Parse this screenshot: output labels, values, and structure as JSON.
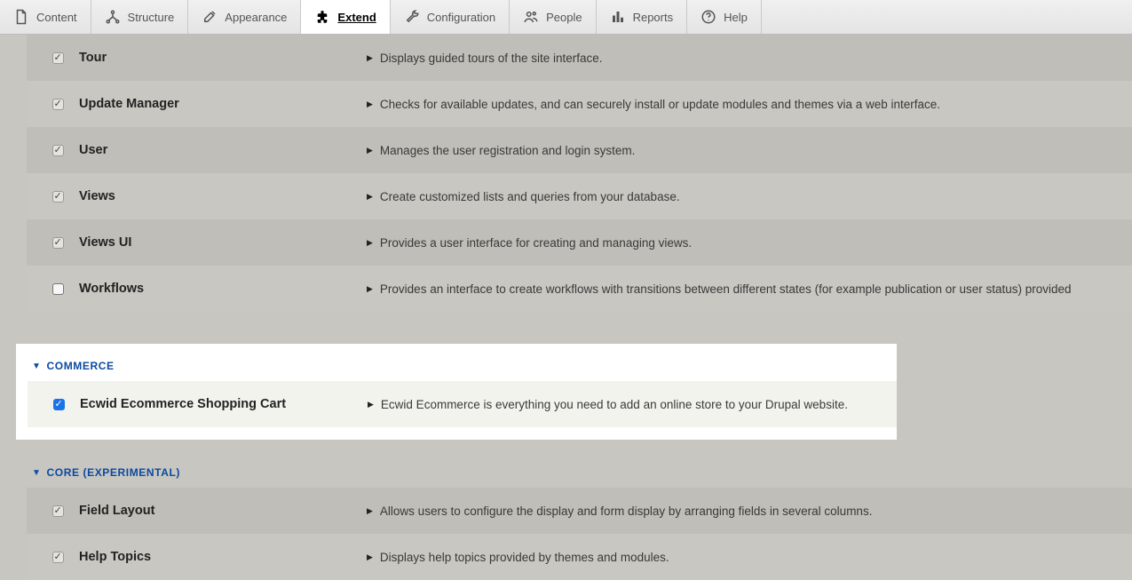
{
  "toolbar": {
    "content": "Content",
    "structure": "Structure",
    "appearance": "Appearance",
    "extend": "Extend",
    "configuration": "Configuration",
    "people": "People",
    "reports": "Reports",
    "help": "Help"
  },
  "sections": {
    "core_top": {
      "rows": [
        {
          "name": "Tour",
          "desc": "Displays guided tours of the site interface.",
          "checked": true,
          "disabled": true
        },
        {
          "name": "Update Manager",
          "desc": "Checks for available updates, and can securely install or update modules and themes via a web interface.",
          "checked": true,
          "disabled": true
        },
        {
          "name": "User",
          "desc": "Manages the user registration and login system.",
          "checked": true,
          "disabled": true
        },
        {
          "name": "Views",
          "desc": "Create customized lists and queries from your database.",
          "checked": true,
          "disabled": true
        },
        {
          "name": "Views UI",
          "desc": "Provides a user interface for creating and managing views.",
          "checked": true,
          "disabled": true
        },
        {
          "name": "Workflows",
          "desc": "Provides an interface to create workflows with transitions between different states (for example publication or user status) provided",
          "checked": false,
          "disabled": false
        }
      ]
    },
    "commerce": {
      "title": "COMMERCE",
      "rows": [
        {
          "name": "Ecwid Ecommerce Shopping Cart",
          "desc": "Ecwid Ecommerce is everything you need to add an online store to your Drupal website.",
          "checked": true,
          "disabled": false,
          "blue": true
        }
      ]
    },
    "core_exp": {
      "title": "CORE (EXPERIMENTAL)",
      "rows": [
        {
          "name": "Field Layout",
          "desc": "Allows users to configure the display and form display by arranging fields in several columns.",
          "checked": true,
          "disabled": true
        },
        {
          "name": "Help Topics",
          "desc": "Displays help topics provided by themes and modules.",
          "checked": true,
          "disabled": true
        }
      ]
    }
  }
}
